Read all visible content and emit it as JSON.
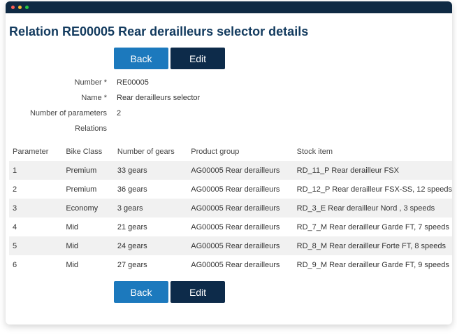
{
  "window": {
    "titlebar_bg": "#0f2a44",
    "dots": [
      {
        "name": "close-dot",
        "color": "#ff5f57"
      },
      {
        "name": "minimize-dot",
        "color": "#febc2e"
      },
      {
        "name": "maximize-dot",
        "color": "#28c840"
      }
    ]
  },
  "page": {
    "title": "Relation RE00005 Rear derailleurs selector details"
  },
  "actions": {
    "back_label": "Back",
    "edit_label": "Edit"
  },
  "fields": [
    {
      "label": "Number *",
      "value": "RE00005"
    },
    {
      "label": "Name *",
      "value": "Rear derailleurs selector"
    },
    {
      "label": "Number of parameters",
      "value": "2"
    },
    {
      "label": "Relations",
      "value": ""
    }
  ],
  "table": {
    "headers": [
      "Parameter",
      "Bike Class",
      "Number of gears",
      "Product group",
      "Stock item"
    ],
    "rows": [
      [
        "1",
        "Premium",
        "33 gears",
        "AG00005 Rear derailleurs",
        "RD_11_P Rear derailleur FSX"
      ],
      [
        "2",
        "Premium",
        "36 gears",
        "AG00005 Rear derailleurs",
        "RD_12_P Rear derailleur FSX-SS, 12 speeds"
      ],
      [
        "3",
        "Economy",
        "3 gears",
        "AG00005 Rear derailleurs",
        "RD_3_E Rear derailleur Nord , 3 speeds"
      ],
      [
        "4",
        "Mid",
        "21 gears",
        "AG00005 Rear derailleurs",
        "RD_7_M Rear derailleur Garde FT, 7 speeds"
      ],
      [
        "5",
        "Mid",
        "24 gears",
        "AG00005 Rear derailleurs",
        "RD_8_M Rear derailleur Forte FT, 8 speeds"
      ],
      [
        "6",
        "Mid",
        "27 gears",
        "AG00005 Rear derailleurs",
        "RD_9_M Rear derailleur Garde FT, 9 speeds"
      ]
    ]
  }
}
